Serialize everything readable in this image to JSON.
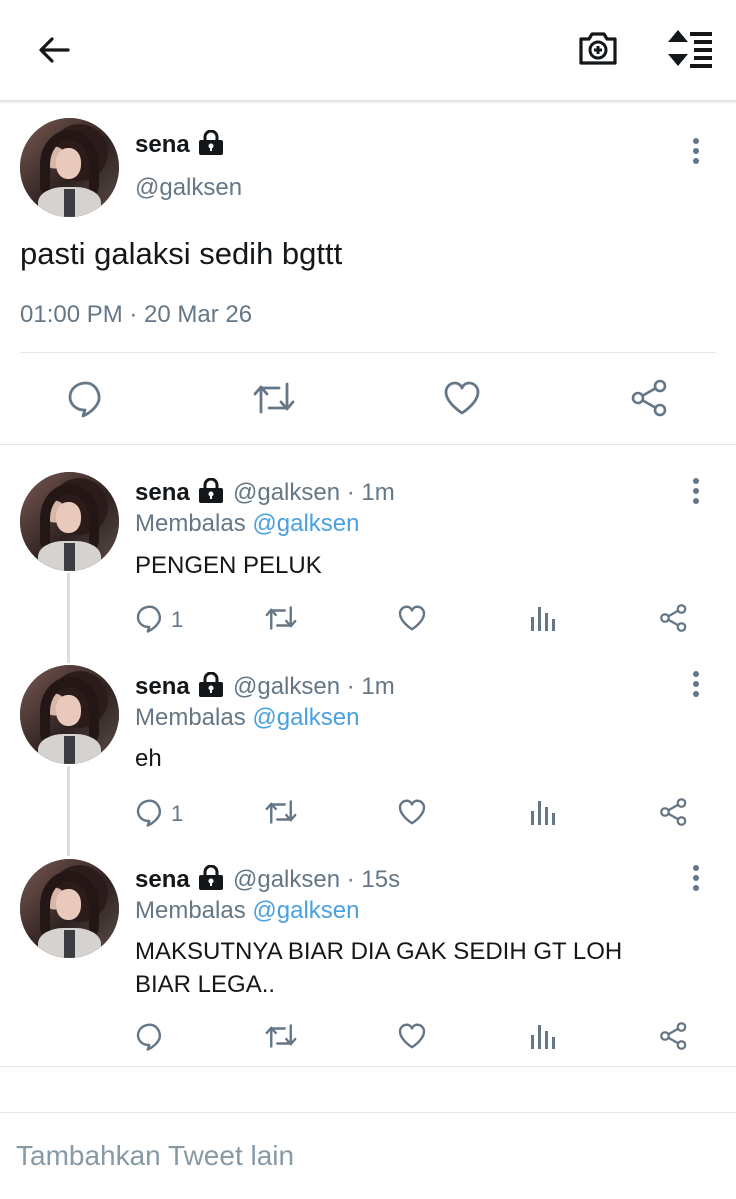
{
  "header": {
    "back_icon": "arrow-left-icon",
    "camera_icon": "camera-add-icon",
    "sort_icon": "sort-list-icon"
  },
  "main_tweet": {
    "name": "sena",
    "lock_icon": "lock-icon",
    "handle": "@galksen",
    "text": "pasti galaksi sedih bgttt",
    "timestamp": "01:00 PM · 20 Mar 26"
  },
  "replies": [
    {
      "name": "sena",
      "handle_time": "@galksen · 1m",
      "replying_prefix": "Membalas",
      "replying_to": "@galksen",
      "text": "PENGEN PELUK",
      "reply_count": "1"
    },
    {
      "name": "sena",
      "handle_time": "@galksen · 1m",
      "replying_prefix": "Membalas",
      "replying_to": "@galksen",
      "text": "eh",
      "reply_count": "1"
    },
    {
      "name": "sena",
      "handle_time": "@galksen · 15s",
      "replying_prefix": "Membalas",
      "replying_to": "@galksen",
      "text_line1": "MAKSUTNYA BIAR DIA GAK SEDIH GT LOH",
      "text_line2": "BIAR LEGA..",
      "reply_count": ""
    }
  ],
  "compose": {
    "placeholder": "Tambahkan Tweet lain"
  },
  "colors": {
    "icon": "#657786",
    "link": "#4aa1e0",
    "text": "#14171a",
    "divider": "#e1e8ed"
  }
}
